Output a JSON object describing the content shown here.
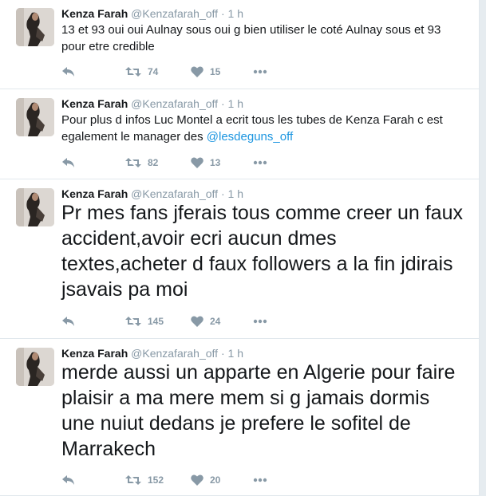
{
  "tweets": [
    {
      "name": "Kenza Farah",
      "handle": "@Kenzafarah_off",
      "separator": "·",
      "time": "1 h",
      "text": "13 et 93 oui oui Aulnay sous oui g bien utiliser le coté Aulnay sous et 93 pour etre credible",
      "mention": "",
      "retweets": "74",
      "likes": "15",
      "icons": [
        "reply-icon",
        "retweet-icon",
        "heart-icon",
        "more-icon"
      ]
    },
    {
      "name": "Kenza Farah",
      "handle": "@Kenzafarah_off",
      "separator": "·",
      "time": "1 h",
      "text": "Pour plus d infos Luc Montel a ecrit tous les tubes de Kenza Farah c est egalement le manager des ",
      "mention": "@lesdeguns_off",
      "retweets": "82",
      "likes": "13",
      "icons": [
        "reply-icon",
        "retweet-icon",
        "heart-icon",
        "more-icon"
      ]
    },
    {
      "name": "Kenza Farah",
      "handle": "@Kenzafarah_off",
      "separator": "·",
      "time": "1 h",
      "text": "Pr mes fans jferais tous comme creer un faux accident,avoir ecri aucun dmes textes,acheter d faux followers a la fin jdirais jsavais pa moi",
      "mention": "",
      "retweets": "145",
      "likes": "24",
      "icons": [
        "reply-icon",
        "retweet-icon",
        "heart-icon",
        "more-icon"
      ]
    },
    {
      "name": "Kenza Farah",
      "handle": "@Kenzafarah_off",
      "separator": "·",
      "time": "1 h",
      "text": "merde aussi un apparte en Algerie pour faire plaisir a ma mere mem si g jamais dormis une nuiut dedans je prefere le sofitel de Marrakech",
      "mention": "",
      "retweets": "152",
      "likes": "20",
      "icons": [
        "reply-icon",
        "retweet-icon",
        "heart-icon",
        "more-icon"
      ]
    }
  ],
  "colors": {
    "text": "#14171a",
    "muted": "#8899a6",
    "link": "#1b95e0",
    "border": "#e1e8ed"
  }
}
